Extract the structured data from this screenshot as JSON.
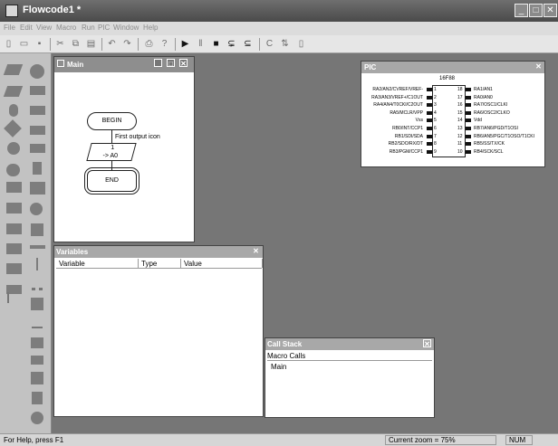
{
  "window": {
    "title": "Flowcode1 *",
    "controls": {
      "minimize": "_",
      "maximize": "□",
      "close": "✕"
    }
  },
  "menu": [
    "File",
    "Edit",
    "View",
    "Macro",
    "Run",
    "PIC",
    "Window",
    "Help"
  ],
  "toolbar": [
    "new-icon",
    "open-icon",
    "save-icon",
    "cut-icon",
    "copy-icon",
    "paste-icon",
    "undo-icon",
    "redo-icon",
    "print-icon",
    "help-icon",
    "run-icon",
    "pause-icon",
    "stop-icon",
    "step-into-icon",
    "step-over-icon",
    "compile-c-icon",
    "compile-hex-icon",
    "chip-icon"
  ],
  "palette_left": [
    "input-icon",
    "output-icon",
    "delay-icon",
    "decision-icon",
    "connection-point-icon",
    "macro-icon",
    "loop-icon",
    "component-macro-icon",
    "calculation-icon",
    "string-icon",
    "interrupt-icon",
    "code-icon",
    "comment-icon"
  ],
  "palette_right": [
    "led-icon",
    "seven-seg-icon",
    "rs232-icon",
    "spi-icon",
    "switch-icon",
    "bluetooth-icon",
    "lcd-icon",
    "keypad-icon",
    "lcd-graphic-icon",
    "line-icon",
    "probe-icon",
    "scatter-icon",
    "grid-icon",
    "triangle-icon",
    "memory-icon",
    "can-icon",
    "panel-icon",
    "eeprom-icon",
    "adc-icon"
  ],
  "main_window": {
    "title": "Main",
    "begin": "BEGIN",
    "comment": "First output icon",
    "output_line1": "1",
    "output_line2": "-> A0",
    "end": "END"
  },
  "pic_window": {
    "title": "PIC",
    "chip": "16F88",
    "left_pins": [
      {
        "num": "1",
        "label": "RA2/AN2/CVREF/VREF-"
      },
      {
        "num": "2",
        "label": "RA3/AN3/VREF+/C1OUT"
      },
      {
        "num": "3",
        "label": "RA4/AN4/T0CKI/C2OUT"
      },
      {
        "num": "4",
        "label": "RA5/MCLR/VPP"
      },
      {
        "num": "5",
        "label": "Vss"
      },
      {
        "num": "6",
        "label": "RB0/INT/CCP1"
      },
      {
        "num": "7",
        "label": "RB1/SDI/SDA"
      },
      {
        "num": "8",
        "label": "RB2/SDO/RX/DT"
      },
      {
        "num": "9",
        "label": "RB3/PGM/CCP1"
      }
    ],
    "right_pins": [
      {
        "num": "18",
        "label": "RA1/AN1"
      },
      {
        "num": "17",
        "label": "RA0/AN0"
      },
      {
        "num": "16",
        "label": "RA7/OSC1/CLKI"
      },
      {
        "num": "15",
        "label": "RA6/OSC2/CLKO"
      },
      {
        "num": "14",
        "label": "Vdd"
      },
      {
        "num": "13",
        "label": "RB7/AN6/PGD/T1OSI"
      },
      {
        "num": "12",
        "label": "RB6/AN5/PGC/T1OSO/T1CKI"
      },
      {
        "num": "11",
        "label": "RB5/SS/TX/CK"
      },
      {
        "num": "10",
        "label": "RB4/SCK/SCL"
      }
    ]
  },
  "variables_window": {
    "title": "Variables",
    "columns": [
      "Variable",
      "Type",
      "Value"
    ]
  },
  "callstack_window": {
    "title": "Call Stack",
    "header": "Macro Calls",
    "items": [
      "Main"
    ]
  },
  "statusbar": {
    "help": "For Help, press F1",
    "zoom": "Current zoom = 75%",
    "num": "NUM"
  }
}
